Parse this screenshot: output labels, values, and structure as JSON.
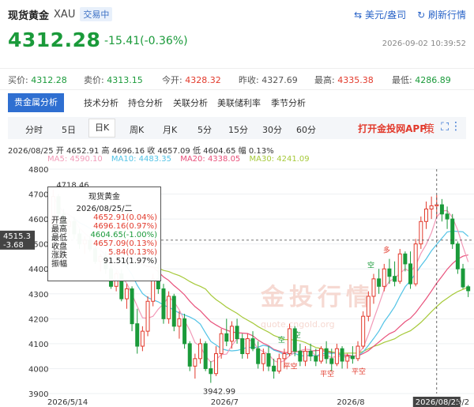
{
  "header": {
    "name": "现货黄金",
    "symbol": "XAU",
    "status": "交易中",
    "currency_link": "美元/盎司",
    "refresh_link": "刷新行情",
    "price": "4312.28",
    "change": "-15.41(-0.36%)",
    "datetime": "2026-09-02 10:39:52"
  },
  "quote": {
    "buy_label": "买价:",
    "buy": "4312.28",
    "sell_label": "卖价:",
    "sell": "4313.15",
    "open_label": "今开:",
    "open": "4328.32",
    "prev_label": "昨收:",
    "prev": "4327.69",
    "high_label": "最高:",
    "high": "4335.38",
    "low_label": "最低:",
    "low": "4286.89"
  },
  "tabs": [
    "贵金属分析",
    "技术分析",
    "持仓分析",
    "关联分析",
    "美联储利率",
    "季节分析"
  ],
  "periods": [
    "分时",
    "5日",
    "日K",
    "周K",
    "月K",
    "5分",
    "15分",
    "30分",
    "60分"
  ],
  "selected_period": "日K",
  "app_link": "打开金投网APP",
  "toolbar_icons": [
    "strategy-icon",
    "fullscreen-icon",
    "more-icon"
  ],
  "toolbar_glyphs": {
    "strategy": "策",
    "fullscreen": "⛶",
    "more": "⋮"
  },
  "ohlc_line": "2026/08/25  开 4652.91  高 4696.16  收 4657.09  低 4604.65  幅 0.13%",
  "ma_line": {
    "ma5": "MA5: 4590.10",
    "ma10": "MA10: 4483.35",
    "ma20": "MA20: 4338.05",
    "ma30": "MA30: 4241.09"
  },
  "colors": {
    "up": "#e23a2c",
    "down": "#1a9a3a",
    "ma5": "#f29ab8",
    "ma10": "#52c3e6",
    "ma20": "#e8507a",
    "ma30": "#a6c93a",
    "accent": "#2f6fd1"
  },
  "tooltip": {
    "title": "现货黄金",
    "date": "2026/08/25/二",
    "rows": [
      {
        "label": "开盘",
        "value": "4652.91(0.04%)",
        "color": "#e23a2c"
      },
      {
        "label": "最高",
        "value": "4696.16(0.97%)",
        "color": "#e23a2c"
      },
      {
        "label": "最低",
        "value": "4604.65(-1.00%)",
        "color": "#1a9a3a"
      },
      {
        "label": "收盘",
        "value": "4657.09(0.13%)",
        "color": "#e23a2c"
      },
      {
        "label": "涨跌",
        "value": "5.84(0.13%)",
        "color": "#e23a2c"
      },
      {
        "label": "振幅",
        "value": "91.51(1.97%)",
        "color": "#222"
      }
    ]
  },
  "watermark": "金投行情",
  "watermark_sub": "quote.cngold.org",
  "chart_data": {
    "type": "candlestick",
    "ylim": [
      3900,
      4800
    ],
    "yticks": [
      3900,
      4000,
      4100,
      4200,
      4300,
      4400,
      4500,
      4600,
      4700,
      4800
    ],
    "xtick_labels": [
      "2026/5/14",
      "2026/7",
      "2026/8",
      "2026/08/25",
      "9/2"
    ],
    "crosshair_price_label": "4515.3",
    "crosshair_pct_label": "-3.68",
    "max_label": "4718.46",
    "min_label": "3942.99",
    "signals": [
      "多",
      "空",
      "空",
      "平空",
      "平空",
      "平空",
      "空"
    ],
    "candles": [
      {
        "d": "2026/05/14",
        "o": 4580,
        "h": 4718.46,
        "l": 4540,
        "c": 4690
      },
      {
        "d": "2026/05/15",
        "o": 4690,
        "h": 4700,
        "l": 4600,
        "c": 4620
      },
      {
        "d": "2026/05/18",
        "o": 4620,
        "h": 4640,
        "l": 4560,
        "c": 4570
      },
      {
        "d": "2026/05/19",
        "o": 4570,
        "h": 4600,
        "l": 4530,
        "c": 4590
      },
      {
        "d": "2026/05/20",
        "o": 4590,
        "h": 4610,
        "l": 4520,
        "c": 4540
      },
      {
        "d": "2026/05/21",
        "o": 4540,
        "h": 4560,
        "l": 4480,
        "c": 4500
      },
      {
        "d": "2026/05/22",
        "o": 4500,
        "h": 4530,
        "l": 4460,
        "c": 4515
      },
      {
        "d": "2026/05/25",
        "o": 4515,
        "h": 4540,
        "l": 4470,
        "c": 4480
      },
      {
        "d": "2026/05/26",
        "o": 4480,
        "h": 4500,
        "l": 4420,
        "c": 4430
      },
      {
        "d": "2026/05/27",
        "o": 4430,
        "h": 4460,
        "l": 4390,
        "c": 4450
      },
      {
        "d": "2026/05/28",
        "o": 4450,
        "h": 4470,
        "l": 4380,
        "c": 4400
      },
      {
        "d": "2026/05/29",
        "o": 4400,
        "h": 4420,
        "l": 4320,
        "c": 4330
      },
      {
        "d": "2026/06/01",
        "o": 4330,
        "h": 4390,
        "l": 4310,
        "c": 4380
      },
      {
        "d": "2026/06/02",
        "o": 4380,
        "h": 4400,
        "l": 4270,
        "c": 4280
      },
      {
        "d": "2026/06/03",
        "o": 4280,
        "h": 4340,
        "l": 4240,
        "c": 4320
      },
      {
        "d": "2026/06/04",
        "o": 4320,
        "h": 4330,
        "l": 4150,
        "c": 4180
      },
      {
        "d": "2026/06/05",
        "o": 4180,
        "h": 4240,
        "l": 4060,
        "c": 4090
      },
      {
        "d": "2026/06/08",
        "o": 4090,
        "h": 4170,
        "l": 4070,
        "c": 4150
      },
      {
        "d": "2026/06/09",
        "o": 4150,
        "h": 4290,
        "l": 4130,
        "c": 4270
      },
      {
        "d": "2026/06/10",
        "o": 4270,
        "h": 4380,
        "l": 4250,
        "c": 4360
      },
      {
        "d": "2026/06/11",
        "o": 4360,
        "h": 4420,
        "l": 4300,
        "c": 4320
      },
      {
        "d": "2026/06/12",
        "o": 4320,
        "h": 4340,
        "l": 4180,
        "c": 4200
      },
      {
        "d": "2026/06/15",
        "o": 4200,
        "h": 4310,
        "l": 4180,
        "c": 4290
      },
      {
        "d": "2026/06/16",
        "o": 4290,
        "h": 4300,
        "l": 4150,
        "c": 4170
      },
      {
        "d": "2026/06/17",
        "o": 4170,
        "h": 4230,
        "l": 4120,
        "c": 4200
      },
      {
        "d": "2026/06/18",
        "o": 4200,
        "h": 4220,
        "l": 4080,
        "c": 4100
      },
      {
        "d": "2026/06/19",
        "o": 4100,
        "h": 4110,
        "l": 3990,
        "c": 4010
      },
      {
        "d": "2026/06/22",
        "o": 4010,
        "h": 4060,
        "l": 3960,
        "c": 4040
      },
      {
        "d": "2026/06/23",
        "o": 4040,
        "h": 4120,
        "l": 4020,
        "c": 4100
      },
      {
        "d": "2026/06/24",
        "o": 4100,
        "h": 4110,
        "l": 3990,
        "c": 4000
      },
      {
        "d": "2026/06/25",
        "o": 4000,
        "h": 4030,
        "l": 3942.99,
        "c": 3980
      },
      {
        "d": "2026/06/26",
        "o": 3980,
        "h": 4090,
        "l": 3970,
        "c": 4060
      },
      {
        "d": "2026/06/29",
        "o": 4060,
        "h": 4160,
        "l": 4040,
        "c": 4140
      },
      {
        "d": "2026/06/30",
        "o": 4140,
        "h": 4200,
        "l": 4090,
        "c": 4110
      },
      {
        "d": "2026/07/01",
        "o": 4110,
        "h": 4190,
        "l": 4080,
        "c": 4170
      },
      {
        "d": "2026/07/02",
        "o": 4170,
        "h": 4200,
        "l": 4100,
        "c": 4120
      },
      {
        "d": "2026/07/03",
        "o": 4120,
        "h": 4140,
        "l": 4040,
        "c": 4060
      },
      {
        "d": "2026/07/06",
        "o": 4060,
        "h": 4140,
        "l": 4040,
        "c": 4120
      },
      {
        "d": "2026/07/07",
        "o": 4120,
        "h": 4150,
        "l": 4070,
        "c": 4080
      },
      {
        "d": "2026/07/08",
        "o": 4080,
        "h": 4110,
        "l": 4000,
        "c": 4020
      },
      {
        "d": "2026/07/09",
        "o": 4020,
        "h": 4080,
        "l": 3990,
        "c": 4060
      },
      {
        "d": "2026/07/10",
        "o": 4060,
        "h": 4090,
        "l": 3990,
        "c": 4010
      },
      {
        "d": "2026/07/13",
        "o": 4010,
        "h": 4040,
        "l": 3960,
        "c": 3990
      },
      {
        "d": "2026/07/14",
        "o": 3990,
        "h": 4060,
        "l": 3980,
        "c": 4040
      },
      {
        "d": "2026/07/15",
        "o": 4040,
        "h": 4080,
        "l": 4000,
        "c": 4060
      },
      {
        "d": "2026/07/16",
        "o": 4060,
        "h": 4180,
        "l": 4050,
        "c": 4160
      },
      {
        "d": "2026/07/17",
        "o": 4160,
        "h": 4170,
        "l": 4050,
        "c": 4070
      },
      {
        "d": "2026/07/20",
        "o": 4070,
        "h": 4100,
        "l": 4010,
        "c": 4030
      },
      {
        "d": "2026/07/21",
        "o": 4030,
        "h": 4090,
        "l": 4010,
        "c": 4070
      },
      {
        "d": "2026/07/22",
        "o": 4070,
        "h": 4100,
        "l": 4030,
        "c": 4050
      },
      {
        "d": "2026/07/23",
        "o": 4050,
        "h": 4080,
        "l": 4010,
        "c": 4030
      },
      {
        "d": "2026/07/24",
        "o": 4030,
        "h": 4090,
        "l": 4020,
        "c": 4080
      },
      {
        "d": "2026/07/27",
        "o": 4080,
        "h": 4110,
        "l": 4020,
        "c": 4040
      },
      {
        "d": "2026/07/28",
        "o": 4040,
        "h": 4080,
        "l": 3990,
        "c": 4020
      },
      {
        "d": "2026/07/29",
        "o": 4020,
        "h": 4100,
        "l": 4010,
        "c": 4080
      },
      {
        "d": "2026/07/30",
        "o": 4080,
        "h": 4090,
        "l": 4000,
        "c": 4030
      },
      {
        "d": "2026/07/31",
        "o": 4030,
        "h": 4060,
        "l": 4000,
        "c": 4050
      },
      {
        "d": "2026/08/03",
        "o": 4050,
        "h": 4090,
        "l": 4020,
        "c": 4040
      },
      {
        "d": "2026/08/04",
        "o": 4040,
        "h": 4110,
        "l": 4030,
        "c": 4090
      },
      {
        "d": "2026/08/05",
        "o": 4090,
        "h": 4230,
        "l": 4080,
        "c": 4210
      },
      {
        "d": "2026/08/06",
        "o": 4210,
        "h": 4310,
        "l": 4190,
        "c": 4290
      },
      {
        "d": "2026/08/07",
        "o": 4290,
        "h": 4380,
        "l": 4260,
        "c": 4360
      },
      {
        "d": "2026/08/10",
        "o": 4360,
        "h": 4400,
        "l": 4300,
        "c": 4330
      },
      {
        "d": "2026/08/11",
        "o": 4330,
        "h": 4420,
        "l": 4310,
        "c": 4400
      },
      {
        "d": "2026/08/12",
        "o": 4400,
        "h": 4440,
        "l": 4340,
        "c": 4370
      },
      {
        "d": "2026/08/13",
        "o": 4370,
        "h": 4430,
        "l": 4330,
        "c": 4350
      },
      {
        "d": "2026/08/14",
        "o": 4350,
        "h": 4480,
        "l": 4340,
        "c": 4460
      },
      {
        "d": "2026/08/17",
        "o": 4460,
        "h": 4470,
        "l": 4390,
        "c": 4420
      },
      {
        "d": "2026/08/18",
        "o": 4420,
        "h": 4470,
        "l": 4320,
        "c": 4340
      },
      {
        "d": "2026/08/19",
        "o": 4340,
        "h": 4520,
        "l": 4330,
        "c": 4500
      },
      {
        "d": "2026/08/20",
        "o": 4500,
        "h": 4610,
        "l": 4480,
        "c": 4590
      },
      {
        "d": "2026/08/21",
        "o": 4590,
        "h": 4670,
        "l": 4560,
        "c": 4640
      },
      {
        "d": "2026/08/24",
        "o": 4640,
        "h": 4690,
        "l": 4600,
        "c": 4652.91
      },
      {
        "d": "2026/08/25",
        "o": 4652.91,
        "h": 4696.16,
        "l": 4604.65,
        "c": 4657.09
      },
      {
        "d": "2026/08/26",
        "o": 4657.09,
        "h": 4680,
        "l": 4590,
        "c": 4620
      },
      {
        "d": "2026/08/27",
        "o": 4620,
        "h": 4650,
        "l": 4560,
        "c": 4600
      },
      {
        "d": "2026/08/28",
        "o": 4600,
        "h": 4620,
        "l": 4480,
        "c": 4500
      },
      {
        "d": "2026/08/31",
        "o": 4500,
        "h": 4510,
        "l": 4380,
        "c": 4400
      },
      {
        "d": "2026/09/01",
        "o": 4400,
        "h": 4420,
        "l": 4320,
        "c": 4327.69
      },
      {
        "d": "2026/09/02",
        "o": 4328.32,
        "h": 4335.38,
        "l": 4286.89,
        "c": 4312.28
      }
    ]
  }
}
